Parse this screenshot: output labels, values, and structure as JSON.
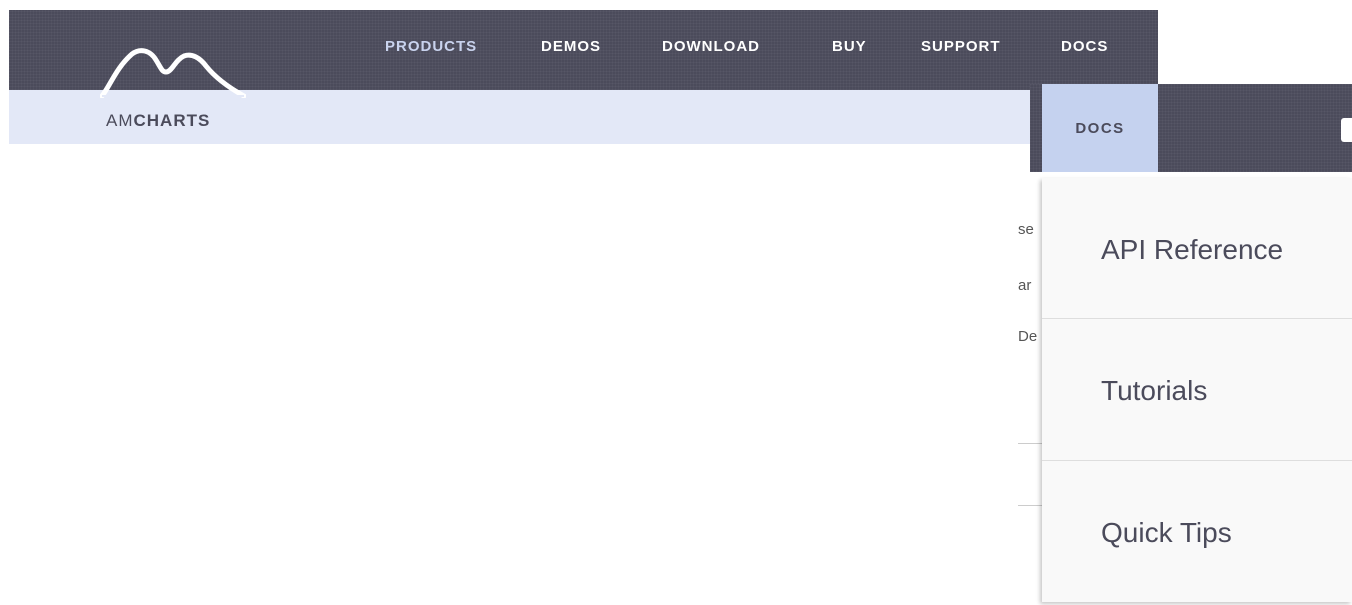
{
  "logo": {
    "text_light": "AM",
    "text_bold": "CHARTS"
  },
  "nav": {
    "items": [
      {
        "label": "PRODUCTS",
        "active": true
      },
      {
        "label": "DEMOS",
        "active": false
      },
      {
        "label": "DOWNLOAD",
        "active": false
      },
      {
        "label": "BUY",
        "active": false
      },
      {
        "label": "SUPPORT",
        "active": false
      },
      {
        "label": "DOCS",
        "active": false
      }
    ]
  },
  "docs_panel": {
    "tab_label": "DOCS",
    "menu": [
      {
        "label": "API Reference"
      },
      {
        "label": "Tutorials"
      },
      {
        "label": "Quick Tips"
      }
    ]
  },
  "peek_text": [
    "se",
    "ar",
    "De"
  ],
  "colors": {
    "header_bg": "#4b4b5b",
    "subbar_bg": "#e3e8f7",
    "active_nav": "#c9d3ee",
    "docs_tab_bg": "#c5d2ef",
    "dropdown_bg": "#f9f9f9"
  }
}
